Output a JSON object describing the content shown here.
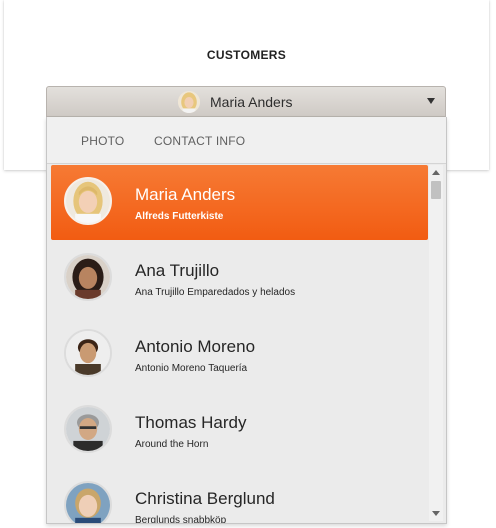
{
  "title": "CUSTOMERS",
  "dropdown": {
    "selected_name": "Maria Anders",
    "avatar_icon": "maria-anders-avatar"
  },
  "columns": {
    "photo": "PHOTO",
    "contact": "CONTACT INFO"
  },
  "accent_color": "#f46a22",
  "customers": [
    {
      "name": "Maria Anders",
      "company": "Alfreds Futterkiste",
      "selected": true
    },
    {
      "name": "Ana Trujillo",
      "company": "Ana Trujillo Emparedados y helados",
      "selected": false
    },
    {
      "name": "Antonio Moreno",
      "company": "Antonio Moreno Taquería",
      "selected": false
    },
    {
      "name": "Thomas Hardy",
      "company": "Around the Horn",
      "selected": false
    },
    {
      "name": "Christina Berglund",
      "company": "Berglunds snabbköp",
      "selected": false
    }
  ]
}
